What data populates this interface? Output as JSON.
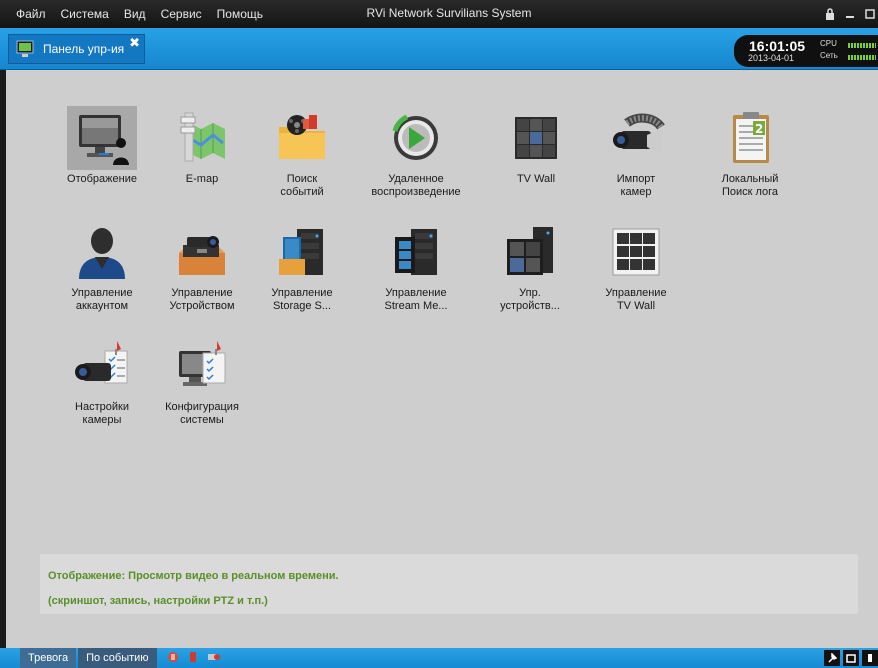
{
  "menu": {
    "items": [
      "Файл",
      "Система",
      "Вид",
      "Сервис",
      "Помощь"
    ],
    "app_title": "RVi Network Survilians System"
  },
  "tab": {
    "label": "Панель упр-ия",
    "close": "✖"
  },
  "clock": {
    "time": "16:01:05",
    "date": "2013-04-01",
    "cpu_label": "CPU",
    "net_label": "Сеть"
  },
  "tiles": [
    {
      "label": "Отображение",
      "icon": "monitor-user-icon",
      "selected": true
    },
    {
      "label": "E-map",
      "icon": "map-icon"
    },
    {
      "label": "Поиск\nсобытий",
      "icon": "event-search-folder-icon"
    },
    {
      "label": "Удаленное\nвоспроизведение",
      "icon": "remote-playback-icon"
    },
    {
      "label": "TV Wall",
      "icon": "tv-wall-icon"
    },
    {
      "label": "Импорт\nкамер",
      "icon": "camera-import-icon"
    },
    {
      "label": "Локальный\nПоиск лога",
      "icon": "log-clipboard-icon"
    },
    {
      "label": "Управление\nаккаунтом",
      "icon": "account-user-icon"
    },
    {
      "label": "Управление\nУстройством",
      "icon": "device-manage-icon"
    },
    {
      "label": "Управление\nStorage S...",
      "icon": "storage-server-icon"
    },
    {
      "label": "Управление\nStream Me...",
      "icon": "stream-media-icon"
    },
    {
      "label": "Упр.\nустройств...",
      "icon": "device-server-icon"
    },
    {
      "label": "Управление\nTV Wall",
      "icon": "tv-wall-manage-icon"
    },
    {
      "label": "Настройки\nкамеры",
      "icon": "camera-settings-icon"
    },
    {
      "label": "Конфигурация\nсистемы",
      "icon": "system-config-icon"
    }
  ],
  "info": {
    "line1": "Отображение: Просмотр видео в реальном времени.",
    "line2": "(скриншот, запись,  настройки PTZ и т.п.)"
  },
  "statusbar": {
    "alarm": "Тревога",
    "by_event": "По событию"
  },
  "colors": {
    "tabbar": "#1b8fd6",
    "main_bg": "#cecece",
    "info_text": "#5a8f2a",
    "cpu_meter": "#7ad32c"
  }
}
